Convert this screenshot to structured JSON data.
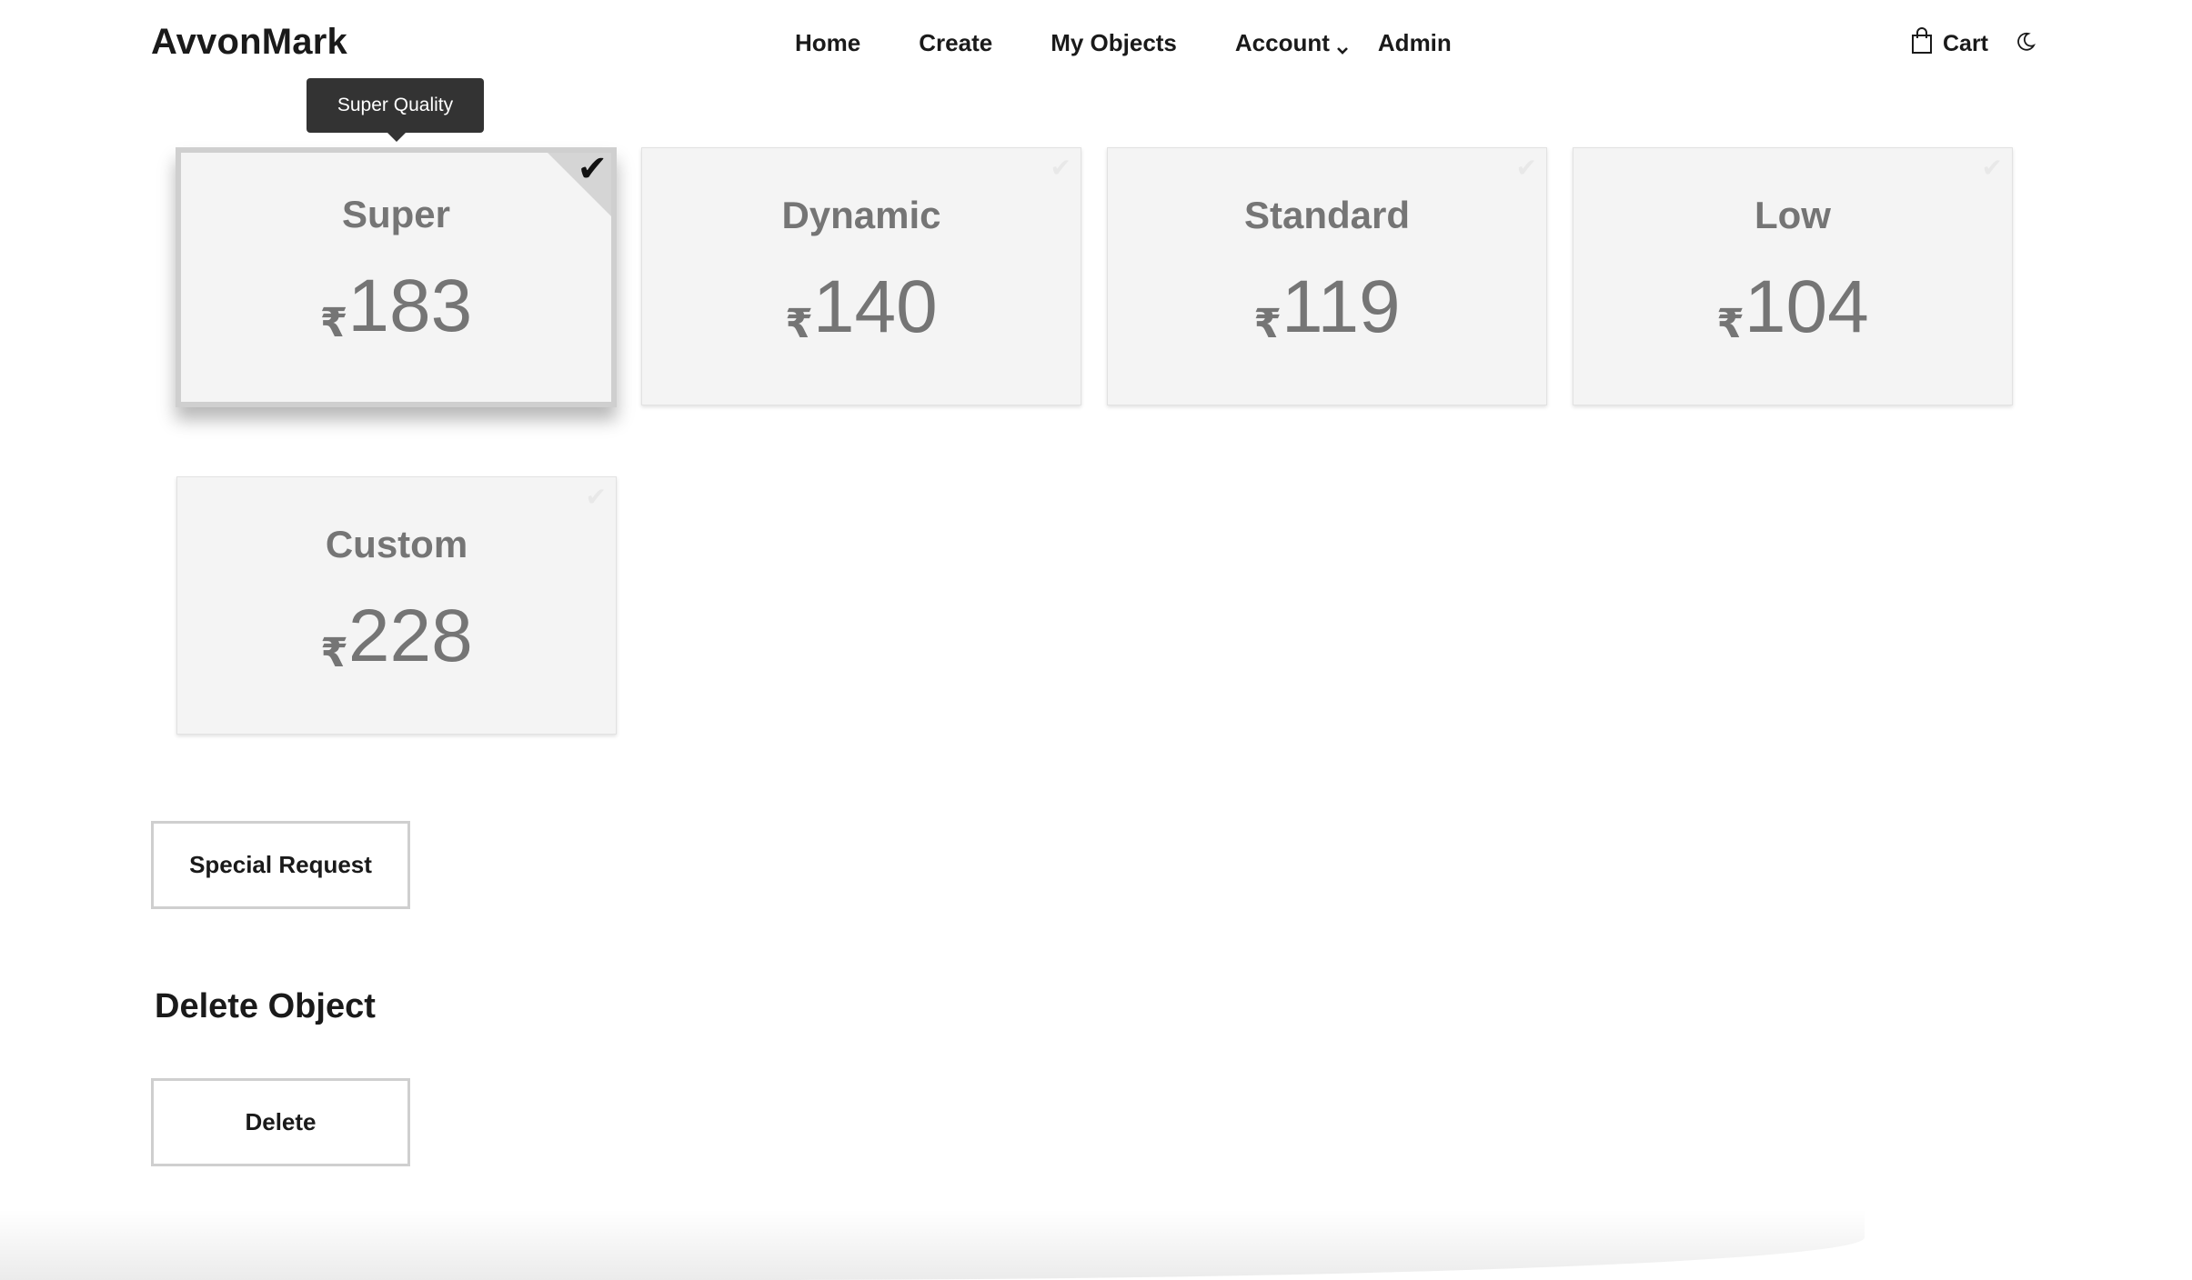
{
  "brand": "AvvonMark",
  "nav": {
    "home": "Home",
    "create": "Create",
    "my_objects": "My Objects",
    "account": "Account",
    "admin": "Admin",
    "cart": "Cart"
  },
  "tooltip": "Super Quality",
  "currency_symbol": "₹",
  "check_symbol": "✔",
  "quality_options": [
    {
      "title": "Super",
      "price": "183",
      "selected": true
    },
    {
      "title": "Dynamic",
      "price": "140",
      "selected": false
    },
    {
      "title": "Standard",
      "price": "119",
      "selected": false
    },
    {
      "title": "Low",
      "price": "104",
      "selected": false
    },
    {
      "title": "Custom",
      "price": "228",
      "selected": false
    }
  ],
  "special_request_label": "Special Request",
  "delete_section": {
    "title": "Delete Object",
    "button_label": "Delete"
  }
}
